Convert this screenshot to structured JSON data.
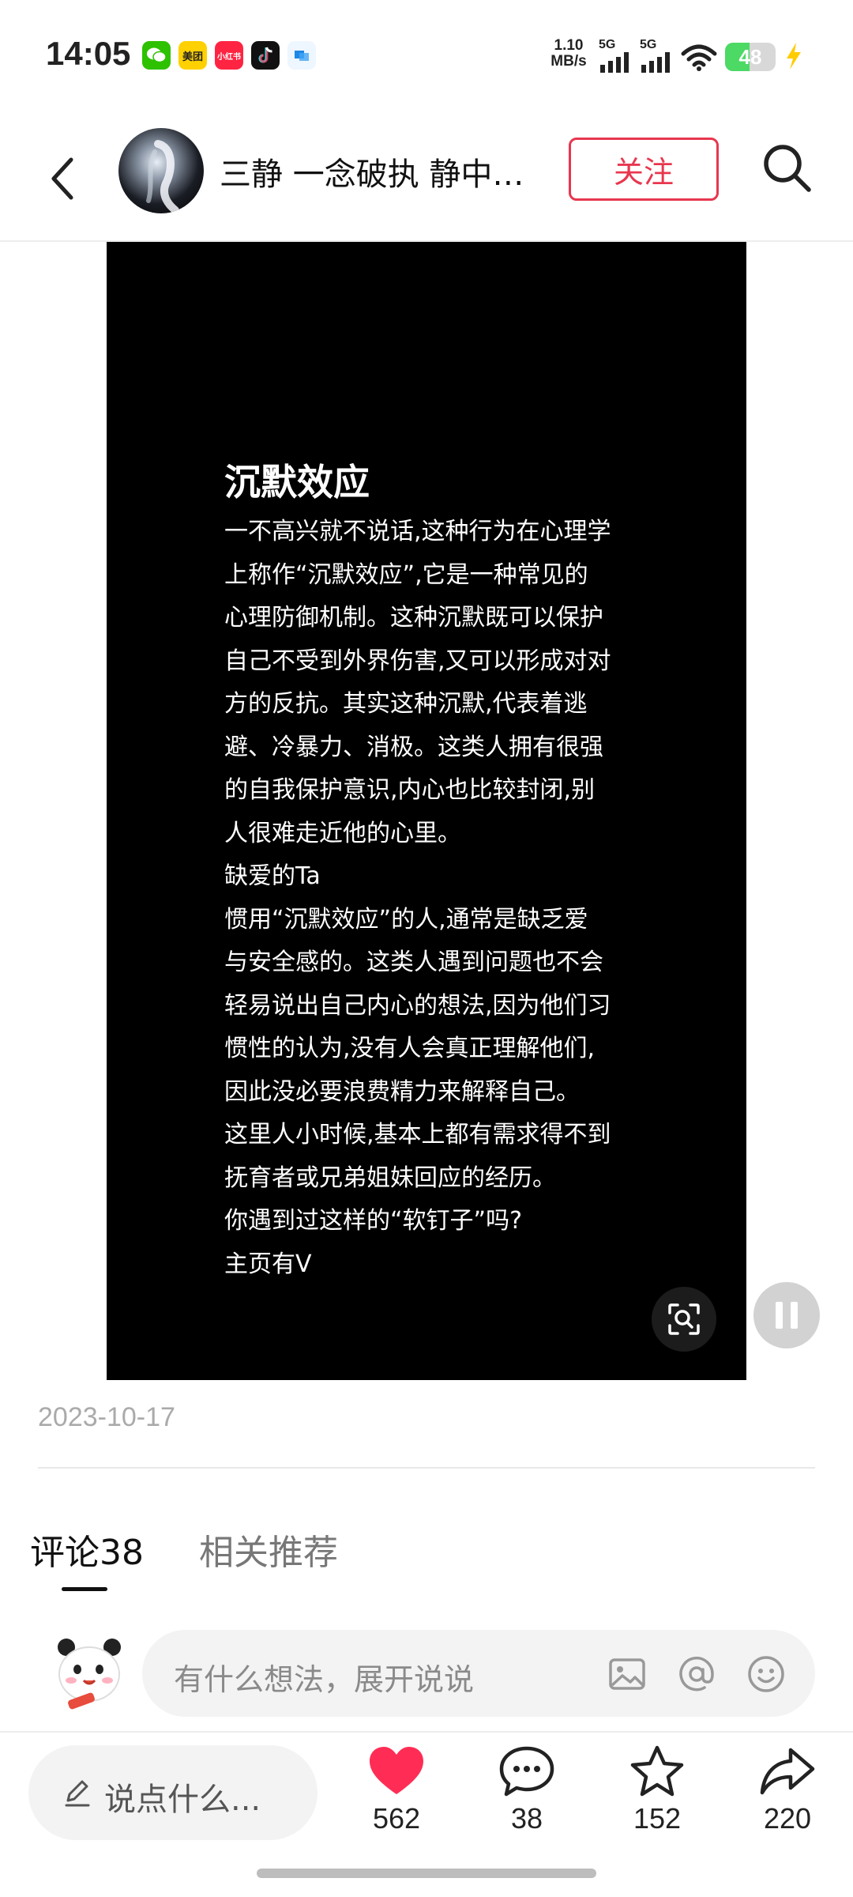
{
  "status_bar": {
    "time": "14:05",
    "net_speed_value": "1.10",
    "net_speed_unit": "MB/s",
    "signal1": "5G",
    "signal2": "5G",
    "battery": "48",
    "battery_level": 0.48,
    "app_icons": [
      "wechat-icon",
      "meituan-icon",
      "xiaohongshu-icon",
      "tiktok-icon",
      "app-icon"
    ],
    "meituan_label": "美团",
    "xiaohongshu_label": "小红书"
  },
  "header": {
    "author_name": "三静 一念破执 静中…",
    "follow_label": "关注"
  },
  "post": {
    "title": "沉默效应",
    "lines": [
      "一不高兴就不说话,这种行为在心理学",
      "上称作“沉默效应”,它是一种常见的",
      "心理防御机制。这种沉默既可以保护",
      "自己不受到外界伤害,又可以形成对对",
      "方的反抗。其实这种沉默,代表着逃",
      "避、冷暴力、消极。这类人拥有很强",
      "的自我保护意识,内心也比较封闭,别",
      "人很难走近他的心里。",
      "缺爱的Ta",
      "惯用“沉默效应”的人,通常是缺乏爱",
      "与安全感的。这类人遇到问题也不会",
      "轻易说出自己内心的想法,因为他们习",
      "惯性的认为,没有人会真正理解他们,",
      "因此没必要浪费精力来解释自己。",
      "这里人小时候,基本上都有需求得不到",
      "抚育者或兄弟姐妹回应的经历。",
      "你遇到过这样的“软钉子”吗?",
      "主页有V"
    ],
    "date": "2023-10-17"
  },
  "tabs": {
    "comments": "评论38",
    "related": "相关推荐"
  },
  "comment_input": {
    "placeholder": "有什么想法，展开说说"
  },
  "bottom_bar": {
    "say_placeholder": "说点什么...",
    "likes": "562",
    "comments": "38",
    "favorites": "152",
    "shares": "220"
  },
  "colors": {
    "accent_red": "#e8374f",
    "like_red": "#ff2d55"
  }
}
